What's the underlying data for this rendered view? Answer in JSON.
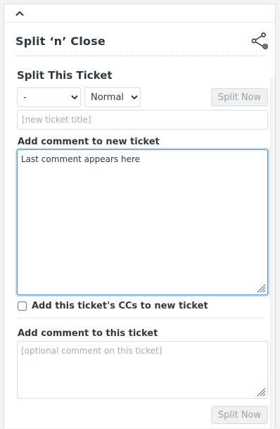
{
  "app": {
    "title": "Split ‘n’ Close"
  },
  "split_section": {
    "heading": "Split This Ticket",
    "selects": [
      {
        "selected": "-"
      },
      {
        "selected": "Normal"
      }
    ],
    "split_button": "Split Now",
    "title_input_placeholder": "[new ticket title]",
    "new_comment_label": "Add comment to new ticket",
    "new_comment_value": "Last comment appears here",
    "copy_ccs_label": "Add this ticket's CCs to new ticket",
    "copy_ccs_checked": false
  },
  "this_ticket_section": {
    "comment_label": "Add comment to this ticket",
    "comment_placeholder": "[optional comment on this ticket]",
    "split_button": "Split Now"
  },
  "icons": {
    "collapse": "chevron-up-icon",
    "share": "share-icon",
    "resize": "resize-grip-icon"
  },
  "colors": {
    "focus": "#5293c7",
    "text": "#2f3941",
    "disabled_button_text": "#9aa3aa"
  }
}
